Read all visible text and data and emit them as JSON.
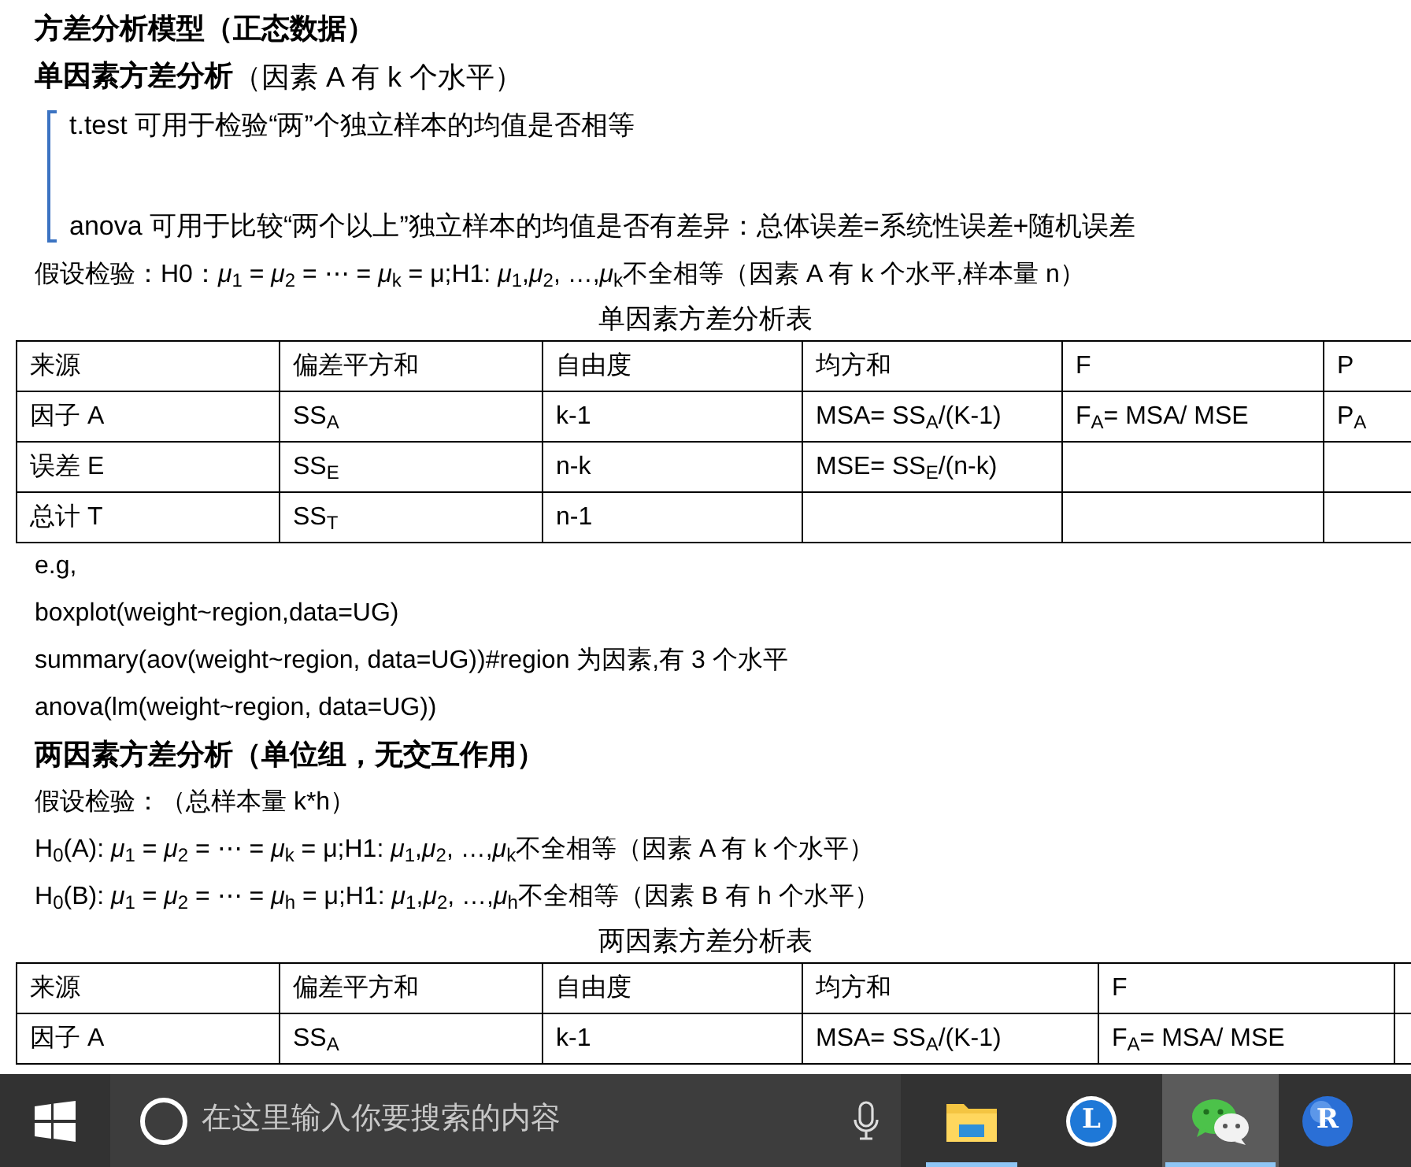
{
  "document": {
    "lines": [
      {
        "kind": "heading",
        "text": "方差分析模型（正态数据）"
      },
      {
        "kind": "heading2",
        "bold": "单因素方差分析",
        "text": "（因素 A 有 k 个水平）"
      },
      {
        "kind": "bracket",
        "items": [
          "t.test 可用于检验“两”个独立样本的均值是否相等",
          "anova 可用于比较“两个以上”独立样本的均值是否有差异：总体误差=系统性误差+随机误差"
        ]
      },
      {
        "kind": "para",
        "text": "假设检验：H0：*μ*$_{1}$ = *μ*$_{2}$ = ⋯ = *μ*$_{k}$ = μ;H1: *μ*$_{1}$,*μ*$_{2}$, …,*μ*$_{k}$不全相等（因素 A 有 k 个水平,样本量 n）"
      },
      {
        "kind": "caption",
        "text": "单因素方差分析表"
      },
      {
        "kind": "table",
        "rows": [
          [
            "来源",
            "偏差平方和",
            "自由度",
            "均方和",
            "F",
            "P"
          ],
          [
            "因子 A",
            "SS$_{A}$",
            "k-1",
            "MSA= SS$_{A}$/(K-1)",
            "F$_{A}$= MSA/ MSE",
            "P$_{A}$"
          ],
          [
            "误差 E",
            "SS$_{E}$",
            "n-k",
            "MSE= SS$_{E}$/(n-k)",
            "",
            ""
          ],
          [
            "总计 T",
            "SS$_{T}$",
            "n-1",
            "",
            "",
            ""
          ]
        ]
      },
      {
        "kind": "para",
        "text": "e.g,"
      },
      {
        "kind": "para",
        "text": "boxplot(weight~region,data=UG)"
      },
      {
        "kind": "para",
        "text": "summary(aov(weight~region, data=UG))#region 为因素,有 3 个水平"
      },
      {
        "kind": "para",
        "text": "anova(lm(weight~region, data=UG))"
      },
      {
        "kind": "heading",
        "text": "两因素方差分析（单位组，无交互作用）"
      },
      {
        "kind": "para",
        "text": "假设检验：（总样本量 k*h）"
      },
      {
        "kind": "para",
        "text": "H$_{0}$(A): *μ*$_{1}$ = *μ*$_{2}$ = ⋯ = *μ*$_{k}$ = μ;H1: *μ*$_{1}$,*μ*$_{2}$, …,*μ*$_{k}$不全相等（因素 A 有 k 个水平）"
      },
      {
        "kind": "para",
        "text": "H$_{0}$(B): *μ*$_{1}$ = *μ*$_{2}$ = ⋯ = *μ*$_{h}$ = μ;H1: *μ*$_{1}$,*μ*$_{2}$, …,*μ*$_{h}$不全相等（因素 B 有 h 个水平）"
      },
      {
        "kind": "caption",
        "text": "两因素方差分析表"
      },
      {
        "kind": "table",
        "rows": [
          [
            "来源",
            "偏差平方和",
            "自由度",
            "均方和",
            "F",
            ""
          ],
          [
            "因子 A",
            "SS$_{A}$",
            "k-1",
            "MSA= SS$_{A}$/(K-1)",
            "F$_{A}$= MSA/ MSE",
            ""
          ]
        ]
      }
    ]
  },
  "taskbar": {
    "search": {
      "placeholder": "在这里输入你要搜索的内容"
    },
    "apps": [
      {
        "kind": "folder",
        "running": true,
        "selected": false
      },
      {
        "kind": "letter",
        "label": "L",
        "running": false,
        "selected": false
      },
      {
        "kind": "chat",
        "running": true,
        "selected": true
      },
      {
        "kind": "r",
        "label": "R",
        "running": false,
        "selected": false
      }
    ]
  }
}
